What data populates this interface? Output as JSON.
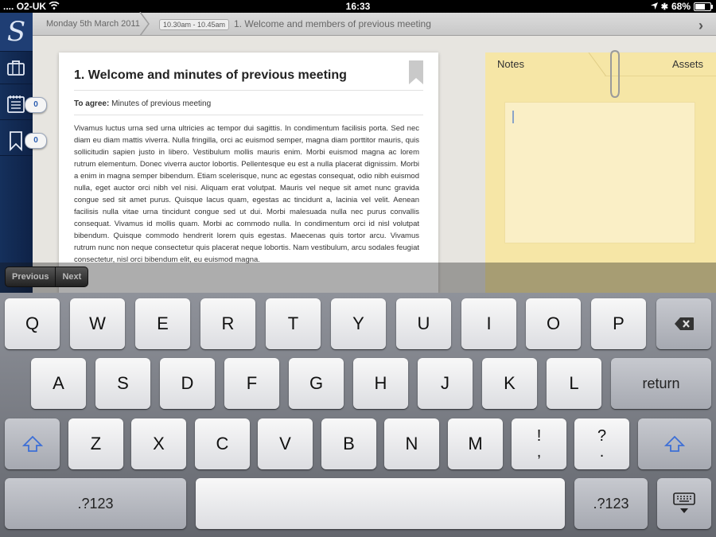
{
  "status": {
    "carrier": "O2-UK",
    "time": "16:33",
    "battery_text": "68%",
    "battery_level_percent": 68
  },
  "topbar": {
    "date": "Monday 5th March 2011",
    "time_range": "10.30am - 10.45am",
    "agenda_item": "1. Welcome and members of previous meeting"
  },
  "sidebar": {
    "agenda_count": "0",
    "bookmark_count": "0"
  },
  "document": {
    "title": "1. Welcome and minutes of previous meeting",
    "agree_label": "To agree:",
    "agree_text": "Minutes of previous meeting",
    "body": "Vivamus luctus urna sed urna ultricies ac tempor dui sagittis. In condimentum facilisis porta. Sed nec diam eu diam mattis viverra. Nulla fringilla, orci ac euismod semper, magna diam porttitor mauris, quis sollicitudin sapien justo in libero. Vestibulum mollis mauris enim. Morbi euismod magna ac lorem rutrum elementum. Donec viverra auctor lobortis. Pellentesque eu est a nulla placerat dignissim. Morbi a enim in magna semper bibendum. Etiam scelerisque, nunc ac egestas consequat, odio nibh euismod nulla, eget auctor orci nibh vel nisi. Aliquam erat volutpat. Mauris vel neque sit amet nunc gravida congue sed sit amet purus. Quisque lacus quam, egestas ac tincidunt a, lacinia vel velit. Aenean facilisis nulla vitae urna tincidunt congue sed ut dui. Morbi malesuada nulla nec purus convallis consequat. Vivamus id mollis quam. Morbi ac commodo nulla. In condimentum orci id nisl volutpat bibendum. Quisque commodo hendrerit lorem quis egestas. Maecenas quis tortor arcu. Vivamus rutrum nunc non neque consectetur quis placerat neque lobortis. Nam vestibulum, arcu sodales feugiat consectetur, nisl orci bibendum elit, eu euismod magna."
  },
  "notes": {
    "notes_tab": "Notes",
    "assets_tab": "Assets"
  },
  "nav": {
    "previous": "Previous",
    "next": "Next"
  },
  "keyboard": {
    "row1": [
      "Q",
      "W",
      "E",
      "R",
      "T",
      "Y",
      "U",
      "I",
      "O",
      "P"
    ],
    "row2": [
      "A",
      "S",
      "D",
      "F",
      "G",
      "H",
      "J",
      "K",
      "L"
    ],
    "row3": [
      "Z",
      "X",
      "C",
      "V",
      "B",
      "N",
      "M"
    ],
    "return": "return",
    "numbers_left": ".?123",
    "numbers_right": ".?123",
    "punct1_top": "!",
    "punct1_bottom": ",",
    "punct2_top": "?",
    "punct2_bottom": "."
  }
}
